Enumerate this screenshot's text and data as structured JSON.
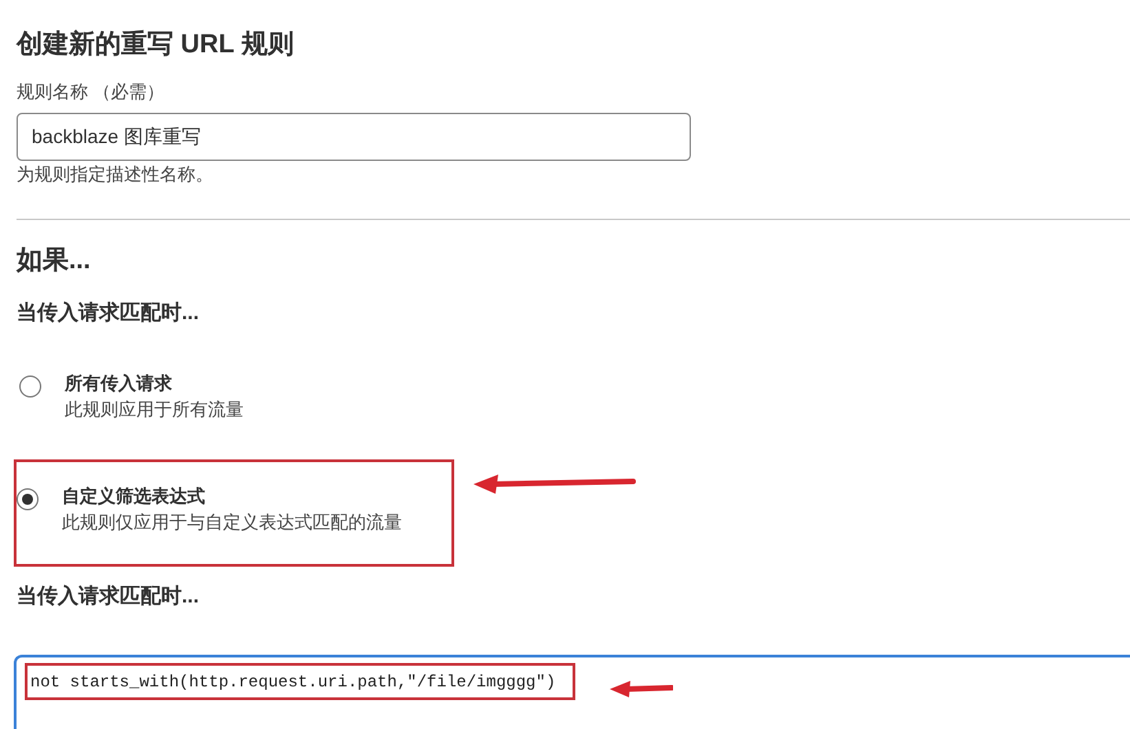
{
  "title": "创建新的重写 URL 规则",
  "rule_name": {
    "label": "规则名称 （必需）",
    "value": "backblaze 图库重写",
    "hint": "为规则指定描述性名称。"
  },
  "condition": {
    "heading": "如果...",
    "subheading": "当传入请求匹配时...",
    "options": [
      {
        "label": "所有传入请求",
        "description": "此规则应用于所有流量",
        "selected": false,
        "highlighted": false
      },
      {
        "label": "自定义筛选表达式",
        "description": "此规则仅应用于与自定义表达式匹配的流量",
        "selected": true,
        "highlighted": true
      }
    ]
  },
  "expression": {
    "heading": "当传入请求匹配时...",
    "value": "not starts_with(http.request.uri.path,\"/file/imgggg\")",
    "highlighted": true
  }
}
